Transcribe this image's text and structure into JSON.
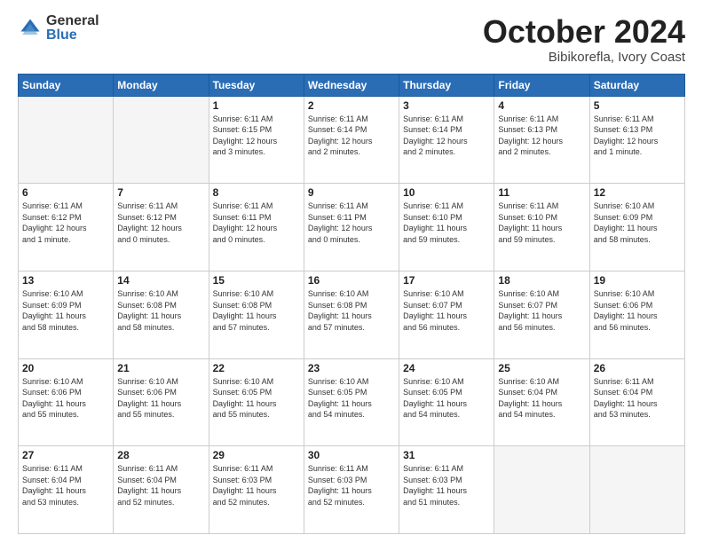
{
  "header": {
    "logo_general": "General",
    "logo_blue": "Blue",
    "month_title": "October 2024",
    "subtitle": "Bibikorefla, Ivory Coast"
  },
  "weekdays": [
    "Sunday",
    "Monday",
    "Tuesday",
    "Wednesday",
    "Thursday",
    "Friday",
    "Saturday"
  ],
  "weeks": [
    [
      {
        "day": "",
        "info": ""
      },
      {
        "day": "",
        "info": ""
      },
      {
        "day": "1",
        "info": "Sunrise: 6:11 AM\nSunset: 6:15 PM\nDaylight: 12 hours\nand 3 minutes."
      },
      {
        "day": "2",
        "info": "Sunrise: 6:11 AM\nSunset: 6:14 PM\nDaylight: 12 hours\nand 2 minutes."
      },
      {
        "day": "3",
        "info": "Sunrise: 6:11 AM\nSunset: 6:14 PM\nDaylight: 12 hours\nand 2 minutes."
      },
      {
        "day": "4",
        "info": "Sunrise: 6:11 AM\nSunset: 6:13 PM\nDaylight: 12 hours\nand 2 minutes."
      },
      {
        "day": "5",
        "info": "Sunrise: 6:11 AM\nSunset: 6:13 PM\nDaylight: 12 hours\nand 1 minute."
      }
    ],
    [
      {
        "day": "6",
        "info": "Sunrise: 6:11 AM\nSunset: 6:12 PM\nDaylight: 12 hours\nand 1 minute."
      },
      {
        "day": "7",
        "info": "Sunrise: 6:11 AM\nSunset: 6:12 PM\nDaylight: 12 hours\nand 0 minutes."
      },
      {
        "day": "8",
        "info": "Sunrise: 6:11 AM\nSunset: 6:11 PM\nDaylight: 12 hours\nand 0 minutes."
      },
      {
        "day": "9",
        "info": "Sunrise: 6:11 AM\nSunset: 6:11 PM\nDaylight: 12 hours\nand 0 minutes."
      },
      {
        "day": "10",
        "info": "Sunrise: 6:11 AM\nSunset: 6:10 PM\nDaylight: 11 hours\nand 59 minutes."
      },
      {
        "day": "11",
        "info": "Sunrise: 6:11 AM\nSunset: 6:10 PM\nDaylight: 11 hours\nand 59 minutes."
      },
      {
        "day": "12",
        "info": "Sunrise: 6:10 AM\nSunset: 6:09 PM\nDaylight: 11 hours\nand 58 minutes."
      }
    ],
    [
      {
        "day": "13",
        "info": "Sunrise: 6:10 AM\nSunset: 6:09 PM\nDaylight: 11 hours\nand 58 minutes."
      },
      {
        "day": "14",
        "info": "Sunrise: 6:10 AM\nSunset: 6:08 PM\nDaylight: 11 hours\nand 58 minutes."
      },
      {
        "day": "15",
        "info": "Sunrise: 6:10 AM\nSunset: 6:08 PM\nDaylight: 11 hours\nand 57 minutes."
      },
      {
        "day": "16",
        "info": "Sunrise: 6:10 AM\nSunset: 6:08 PM\nDaylight: 11 hours\nand 57 minutes."
      },
      {
        "day": "17",
        "info": "Sunrise: 6:10 AM\nSunset: 6:07 PM\nDaylight: 11 hours\nand 56 minutes."
      },
      {
        "day": "18",
        "info": "Sunrise: 6:10 AM\nSunset: 6:07 PM\nDaylight: 11 hours\nand 56 minutes."
      },
      {
        "day": "19",
        "info": "Sunrise: 6:10 AM\nSunset: 6:06 PM\nDaylight: 11 hours\nand 56 minutes."
      }
    ],
    [
      {
        "day": "20",
        "info": "Sunrise: 6:10 AM\nSunset: 6:06 PM\nDaylight: 11 hours\nand 55 minutes."
      },
      {
        "day": "21",
        "info": "Sunrise: 6:10 AM\nSunset: 6:06 PM\nDaylight: 11 hours\nand 55 minutes."
      },
      {
        "day": "22",
        "info": "Sunrise: 6:10 AM\nSunset: 6:05 PM\nDaylight: 11 hours\nand 55 minutes."
      },
      {
        "day": "23",
        "info": "Sunrise: 6:10 AM\nSunset: 6:05 PM\nDaylight: 11 hours\nand 54 minutes."
      },
      {
        "day": "24",
        "info": "Sunrise: 6:10 AM\nSunset: 6:05 PM\nDaylight: 11 hours\nand 54 minutes."
      },
      {
        "day": "25",
        "info": "Sunrise: 6:10 AM\nSunset: 6:04 PM\nDaylight: 11 hours\nand 54 minutes."
      },
      {
        "day": "26",
        "info": "Sunrise: 6:11 AM\nSunset: 6:04 PM\nDaylight: 11 hours\nand 53 minutes."
      }
    ],
    [
      {
        "day": "27",
        "info": "Sunrise: 6:11 AM\nSunset: 6:04 PM\nDaylight: 11 hours\nand 53 minutes."
      },
      {
        "day": "28",
        "info": "Sunrise: 6:11 AM\nSunset: 6:04 PM\nDaylight: 11 hours\nand 52 minutes."
      },
      {
        "day": "29",
        "info": "Sunrise: 6:11 AM\nSunset: 6:03 PM\nDaylight: 11 hours\nand 52 minutes."
      },
      {
        "day": "30",
        "info": "Sunrise: 6:11 AM\nSunset: 6:03 PM\nDaylight: 11 hours\nand 52 minutes."
      },
      {
        "day": "31",
        "info": "Sunrise: 6:11 AM\nSunset: 6:03 PM\nDaylight: 11 hours\nand 51 minutes."
      },
      {
        "day": "",
        "info": ""
      },
      {
        "day": "",
        "info": ""
      }
    ]
  ]
}
